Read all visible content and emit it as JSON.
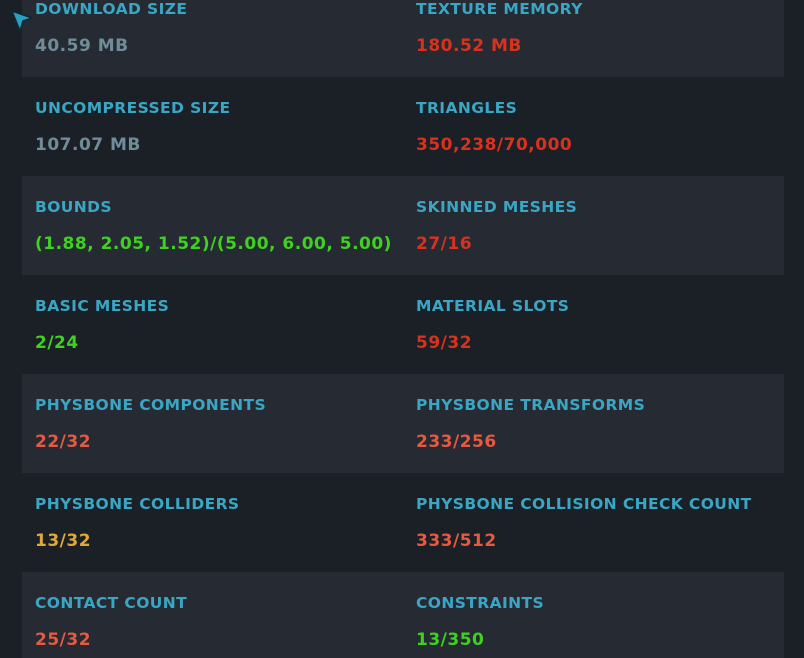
{
  "colors": {
    "background": "#1b1f26",
    "row_shade": "#262a33",
    "label": "#3aa6c4",
    "gray": "#6f8d99",
    "red": "#d8321f",
    "green": "#3fd11f",
    "salmon": "#e55a40",
    "yellow": "#e0a83a"
  },
  "stats": [
    {
      "left": {
        "label": "DOWNLOAD SIZE",
        "value": "40.59 MB",
        "status": "gray"
      },
      "right": {
        "label": "TEXTURE MEMORY",
        "value": "180.52 MB",
        "status": "red"
      }
    },
    {
      "left": {
        "label": "UNCOMPRESSED SIZE",
        "value": "107.07 MB",
        "status": "gray"
      },
      "right": {
        "label": "TRIANGLES",
        "value": "350,238/70,000",
        "status": "red"
      }
    },
    {
      "left": {
        "label": "BOUNDS",
        "value": "(1.88, 2.05, 1.52)/(5.00, 6.00, 5.00)",
        "status": "green"
      },
      "right": {
        "label": "SKINNED MESHES",
        "value": "27/16",
        "status": "red"
      }
    },
    {
      "left": {
        "label": "BASIC MESHES",
        "value": "2/24",
        "status": "green"
      },
      "right": {
        "label": "MATERIAL SLOTS",
        "value": "59/32",
        "status": "red"
      }
    },
    {
      "left": {
        "label": "PHYSBONE COMPONENTS",
        "value": "22/32",
        "status": "salmon"
      },
      "right": {
        "label": "PHYSBONE TRANSFORMS",
        "value": "233/256",
        "status": "salmon"
      }
    },
    {
      "left": {
        "label": "PHYSBONE COLLIDERS",
        "value": "13/32",
        "status": "yellow"
      },
      "right": {
        "label": "PHYSBONE COLLISION CHECK COUNT",
        "value": "333/512",
        "status": "salmon"
      }
    },
    {
      "left": {
        "label": "CONTACT COUNT",
        "value": "25/32",
        "status": "salmon"
      },
      "right": {
        "label": "CONSTRAINTS",
        "value": "13/350",
        "status": "green"
      }
    }
  ],
  "cursor": {
    "icon": "pointer-arrow-icon",
    "color": "#2aa0c4"
  }
}
